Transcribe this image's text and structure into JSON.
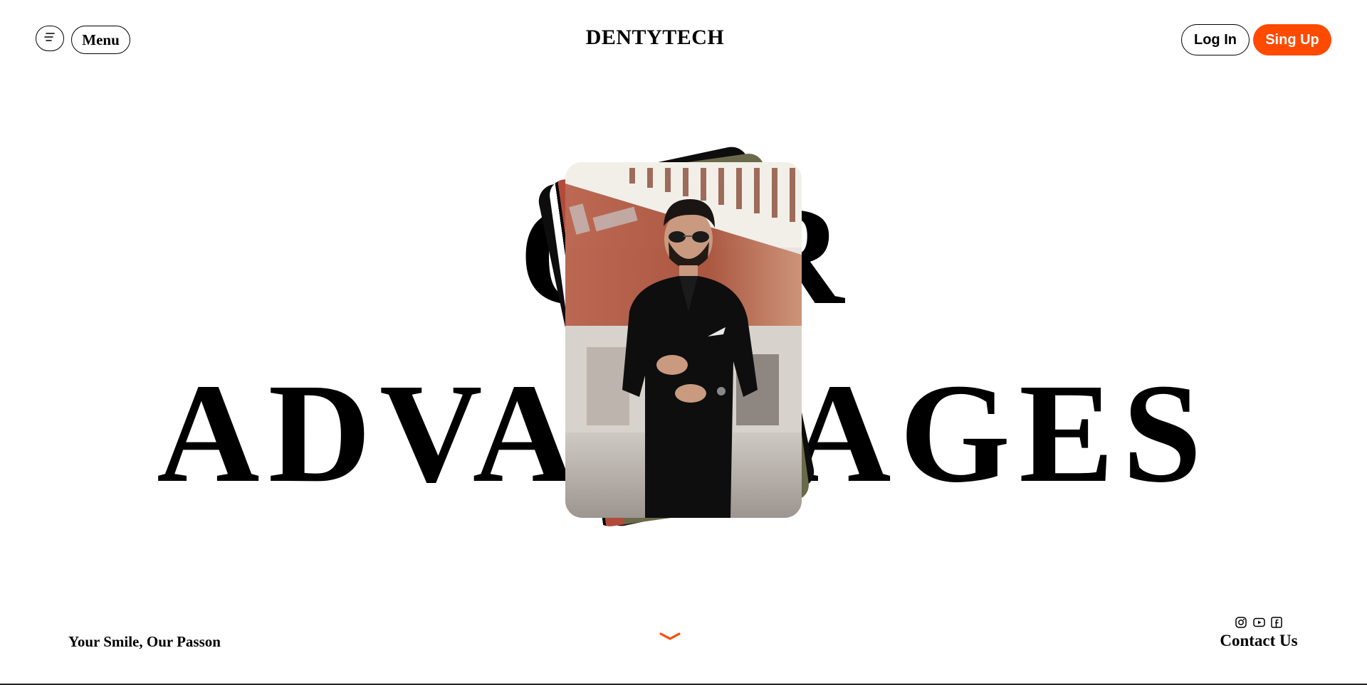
{
  "header": {
    "menu_label": "Menu",
    "brand": "DENTYTECH",
    "login_label": "Log In",
    "signup_label": "Sing Up"
  },
  "hero": {
    "line1": "OUR",
    "line2": "ADVANTAGES"
  },
  "footer": {
    "tagline": "Your Smile, Our Passon",
    "contact_label": "Contact Us",
    "social_icons": [
      "instagram-icon",
      "youtube-icon",
      "facebook-icon"
    ]
  },
  "colors": {
    "accent": "#ff4a00",
    "text": "#000000",
    "background": "#ffffff"
  }
}
